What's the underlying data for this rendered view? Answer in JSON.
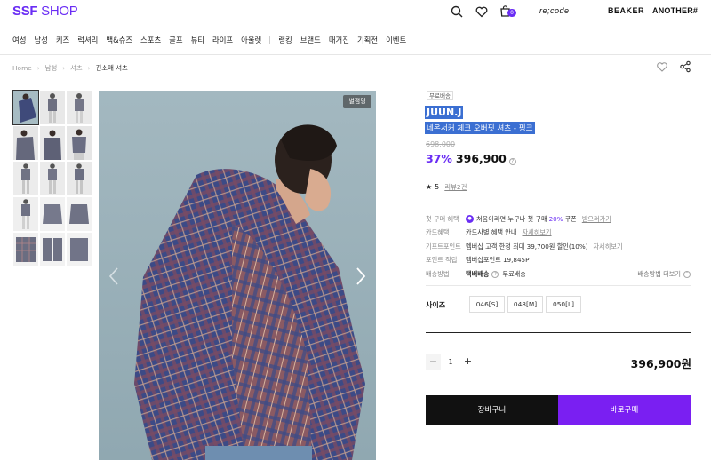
{
  "header": {
    "logo_bold": "SSF",
    "logo_text": "SHOP",
    "cart_count": "0",
    "brand_links": [
      "re;code",
      "BEAKER",
      "ANOTHER#"
    ]
  },
  "nav": {
    "categories": [
      "여성",
      "남성",
      "키즈",
      "럭셔리",
      "백&슈즈",
      "스포츠",
      "골프",
      "뷰티",
      "라이프",
      "아울렛"
    ],
    "secondary": [
      "랭킹",
      "브랜드",
      "매거진",
      "기획전",
      "이벤트"
    ]
  },
  "breadcrumb": [
    "Home",
    "남성",
    "셔츠",
    "긴소매 셔츠"
  ],
  "gallery": {
    "badge": "별점딩",
    "thumbnail_count": 15
  },
  "product": {
    "free_shipping": "무료배송",
    "brand": "JUUN.J",
    "name": "네온서커 체크 오버핏 셔츠 - 핑크",
    "original_price": "698,000",
    "discount": "37%",
    "price": "396,900",
    "rating": "5",
    "reviews": "리뷰2건"
  },
  "benefits": {
    "rows": [
      {
        "label": "첫 구매 혜택",
        "text": "처음이라면 누구나 첫 구매",
        "highlight": "20%",
        "text2": "쿠폰",
        "link": "받으러가기"
      },
      {
        "label": "카드혜택",
        "text": "카드사별 혜택 안내",
        "link": "자세히보기"
      },
      {
        "label": "기프트포인트",
        "text": "멤버십 고객 한정 최대 39,700원 할인(10%)",
        "link": "자세히보기"
      },
      {
        "label": "포인트 적립",
        "text": "멤버십포인트 19,845P"
      },
      {
        "label": "배송방법",
        "bold": "택배배송",
        "text": "무료배송",
        "more": "배송방법 더보기"
      }
    ]
  },
  "sizes": {
    "label": "사이즈",
    "options": [
      "046[S]",
      "048[M]",
      "050[L]"
    ]
  },
  "order": {
    "quantity": "1",
    "minus": "−",
    "plus": "+",
    "total": "396,900원",
    "cart_label": "장바구니",
    "buy_label": "바로구매"
  },
  "colors": {
    "accent": "#6a2df4",
    "buy": "#7a1ff2",
    "selection": "#3b6fd2"
  }
}
